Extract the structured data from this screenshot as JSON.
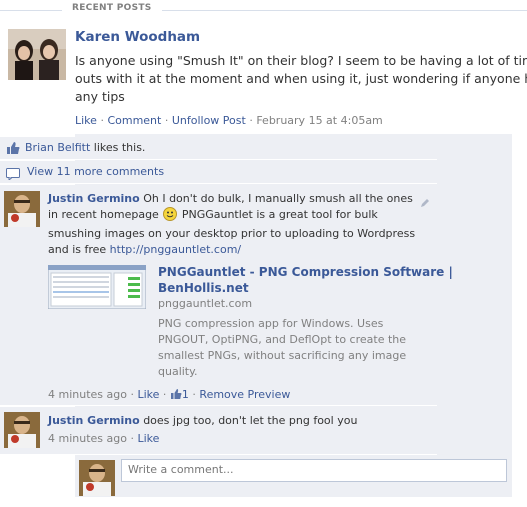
{
  "section": {
    "title": "RECENT POSTS"
  },
  "post": {
    "author": "Karen Woodham",
    "lines": [
      "Is anyone using \"Smush It\" on their blog? I seem to be having a lot of tim",
      "outs with it at the moment and when using it, just wondering if anyone ha",
      "any tips"
    ],
    "actions": {
      "like": "Like",
      "comment": "Comment",
      "unfollow": "Unfollow Post",
      "timestamp": "February 15 at 4:05am",
      "sep": "·"
    }
  },
  "likes": {
    "name": "Brian Belfitt",
    "suffix": "likes this."
  },
  "more_comments": {
    "label": "View 11 more comments"
  },
  "comments": [
    {
      "author": "Justin Germino",
      "text_lines": [
        "Oh I don't do bulk, I manually smush all the ones",
        "in recent homepage",
        "PNGGauntlet is a great tool for bulk",
        "smushing images on your desktop prior to uploading to Wordpress",
        "and is free"
      ],
      "link": "http://pnggauntlet.com/",
      "preview": {
        "title_line1": "PNGGauntlet - PNG Compression Software |",
        "title_line2": "BenHollis.net",
        "domain": "pnggauntlet.com",
        "desc_lines": [
          "PNG compression app for Windows. Uses",
          "PNGOUT, OptiPNG, and DeflOpt to create the",
          "smallest PNGs, without sacrificing any image",
          "quality."
        ]
      },
      "time": "4 minutes ago",
      "like": "Like",
      "like_count": "1",
      "remove_preview": "Remove Preview"
    },
    {
      "author": "Justin Germino",
      "text": "does jpg too, don't let the png fool you",
      "time": "4 minutes ago",
      "like": "Like"
    }
  ],
  "composer": {
    "placeholder": "Write a comment..."
  },
  "colors": {
    "link": "#3b5998",
    "ufi_bg": "#edeff4",
    "meta": "#808080"
  }
}
